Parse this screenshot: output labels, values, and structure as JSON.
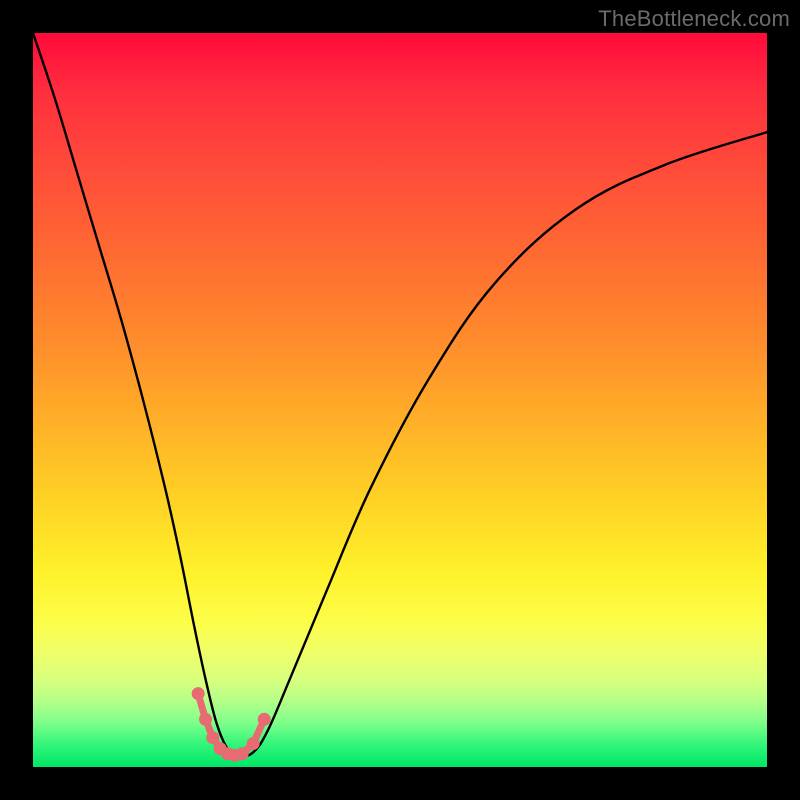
{
  "watermark": "TheBottleneck.com",
  "chart_data": {
    "type": "line",
    "title": "",
    "xlabel": "",
    "ylabel": "",
    "xlim": [
      0,
      100
    ],
    "ylim": [
      0,
      100
    ],
    "grid": false,
    "legend": false,
    "series": [
      {
        "name": "bottleneck-curve",
        "x": [
          0,
          3,
          6,
          9,
          12,
          15,
          18,
          20,
          22,
          23.5,
          25,
          26.5,
          28,
          30,
          32,
          35,
          40,
          46,
          54,
          63,
          74,
          86,
          100
        ],
        "y": [
          100,
          91,
          81,
          71,
          61,
          50,
          38,
          29,
          19,
          12,
          6,
          2.5,
          1.5,
          2,
          5,
          12,
          24,
          38,
          53,
          66,
          76,
          82,
          86.5
        ]
      }
    ],
    "markers": {
      "name": "highlight-range",
      "color": "#e86a72",
      "x": [
        22.5,
        23.5,
        24.5,
        25.5,
        26.5,
        27.5,
        28.5,
        30.0,
        31.5
      ],
      "y": [
        10.0,
        6.5,
        4.0,
        2.5,
        1.8,
        1.6,
        1.8,
        3.2,
        6.5
      ]
    },
    "background_gradient": {
      "top": "#ff0a3a",
      "mid": "#ffd325",
      "bottom": "#00e765"
    }
  }
}
